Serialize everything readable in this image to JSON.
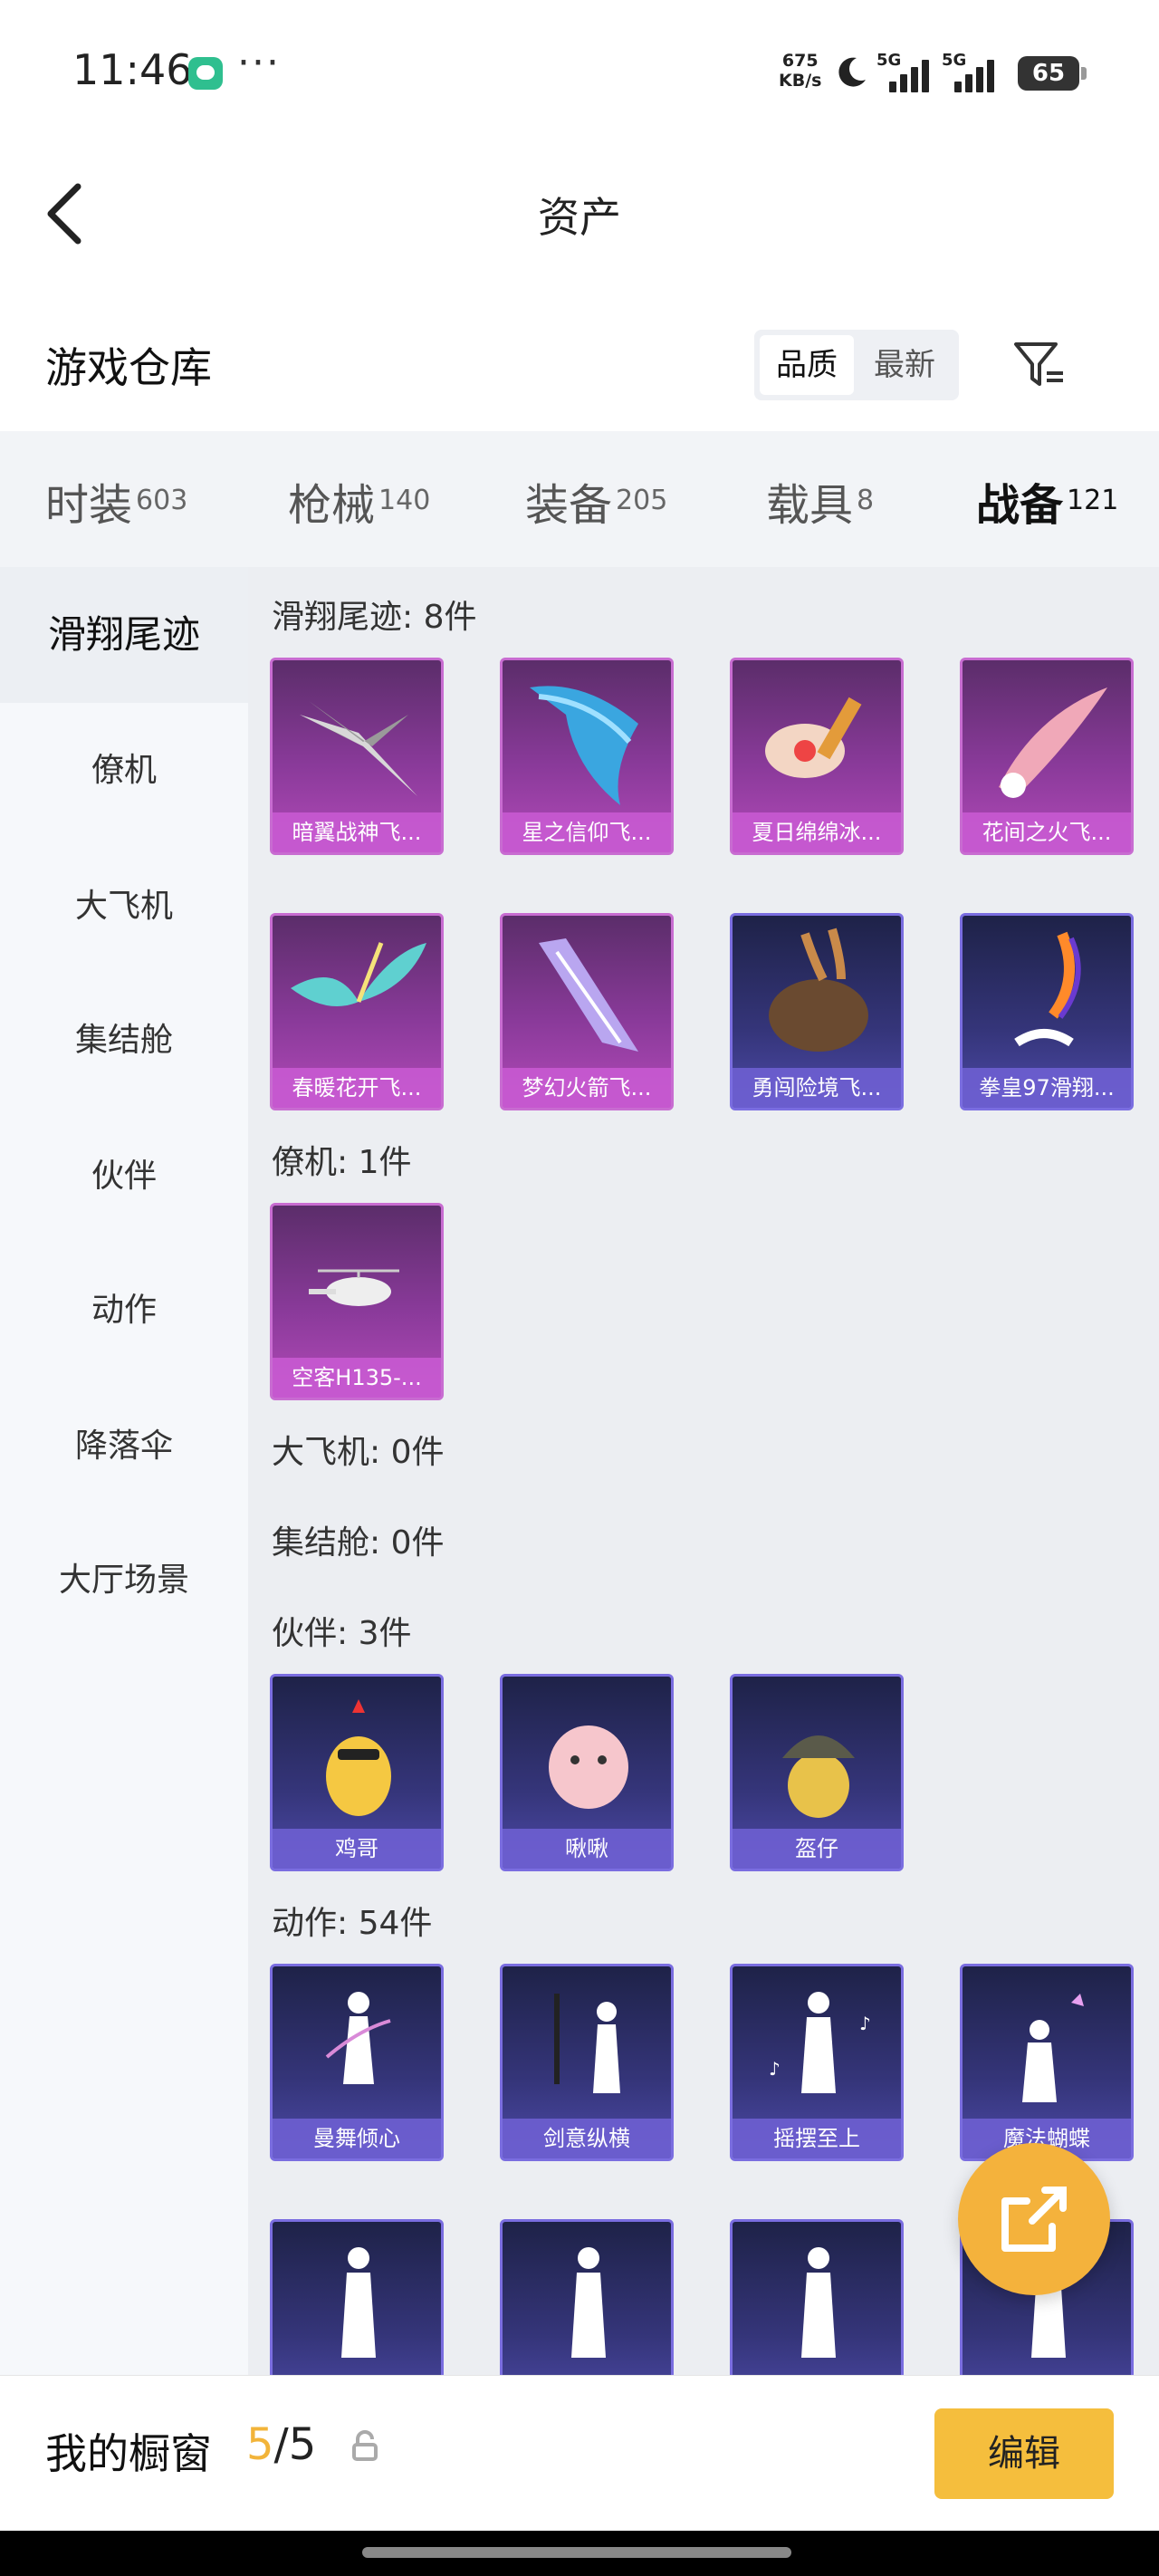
{
  "status": {
    "time": "11:46",
    "dots": "···",
    "speed_value": "675",
    "speed_unit": "KB/s",
    "sig1_label": "5G",
    "sig2_label": "5G",
    "battery": "65"
  },
  "header": {
    "title": "资产"
  },
  "warehouse": {
    "title": "游戏仓库",
    "sort_quality": "品质",
    "sort_newest": "最新"
  },
  "tabs": [
    {
      "name": "时装",
      "count": "603"
    },
    {
      "name": "枪械",
      "count": "140"
    },
    {
      "name": "装备",
      "count": "205"
    },
    {
      "name": "载具",
      "count": "8"
    },
    {
      "name": "战备",
      "count": "121"
    }
  ],
  "sidebar": {
    "items": [
      "滑翔尾迹",
      "僚机",
      "大飞机",
      "集结舱",
      "伙伴",
      "动作",
      "降落伞",
      "大厅场景"
    ]
  },
  "sections": {
    "glide_title": "滑翔尾迹: 8件",
    "glide_items": [
      "暗翼战神飞...",
      "星之信仰飞...",
      "夏日绵绵冰...",
      "花间之火飞...",
      "春暖花开飞...",
      "梦幻火箭飞...",
      "勇闯险境飞...",
      "拳皇97滑翔..."
    ],
    "wing_title": "僚机: 1件",
    "wing_items": [
      "空客H135-..."
    ],
    "plane_title": "大飞机: 0件",
    "pod_title": "集结舱: 0件",
    "partner_title": "伙伴: 3件",
    "partner_items": [
      "鸡哥",
      "啾啾",
      "盔仔"
    ],
    "action_title": "动作: 54件",
    "action_items": [
      "曼舞倾心",
      "剑意纵横",
      "摇摆至上",
      "魔法蝴蝶"
    ]
  },
  "bottom": {
    "label": "我的橱窗",
    "current": "5",
    "total": "/5",
    "edit": "编辑"
  },
  "colors": {
    "accent": "#f2a52b",
    "edit_button": "#f5be3d",
    "legendary": "#b24ab8",
    "epic": "#4d4aa8"
  }
}
